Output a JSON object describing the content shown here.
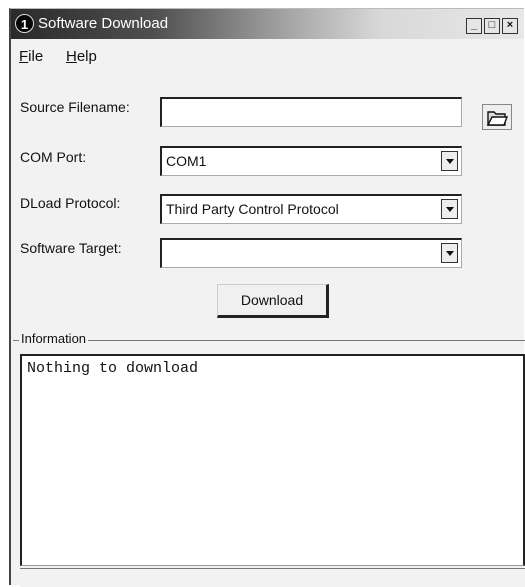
{
  "window": {
    "title": "Software Download",
    "app_icon_text": "1",
    "controls": {
      "minimize": "_",
      "maximize": "□",
      "close": "×"
    }
  },
  "menu": {
    "file": {
      "mnemonic": "F",
      "rest": "ile"
    },
    "help": {
      "mnemonic": "H",
      "rest": "elp"
    }
  },
  "form": {
    "source_filename_label": "Source Filename:",
    "source_filename_value": "",
    "com_port_label": "COM Port:",
    "com_port_value": "COM1",
    "dload_protocol_label": "DLoad Protocol:",
    "dload_protocol_value": "Third Party Control Protocol",
    "software_target_label": "Software Target:",
    "software_target_value": "",
    "download_button": "Download"
  },
  "information": {
    "label": "Information",
    "text": "Nothing to download"
  }
}
